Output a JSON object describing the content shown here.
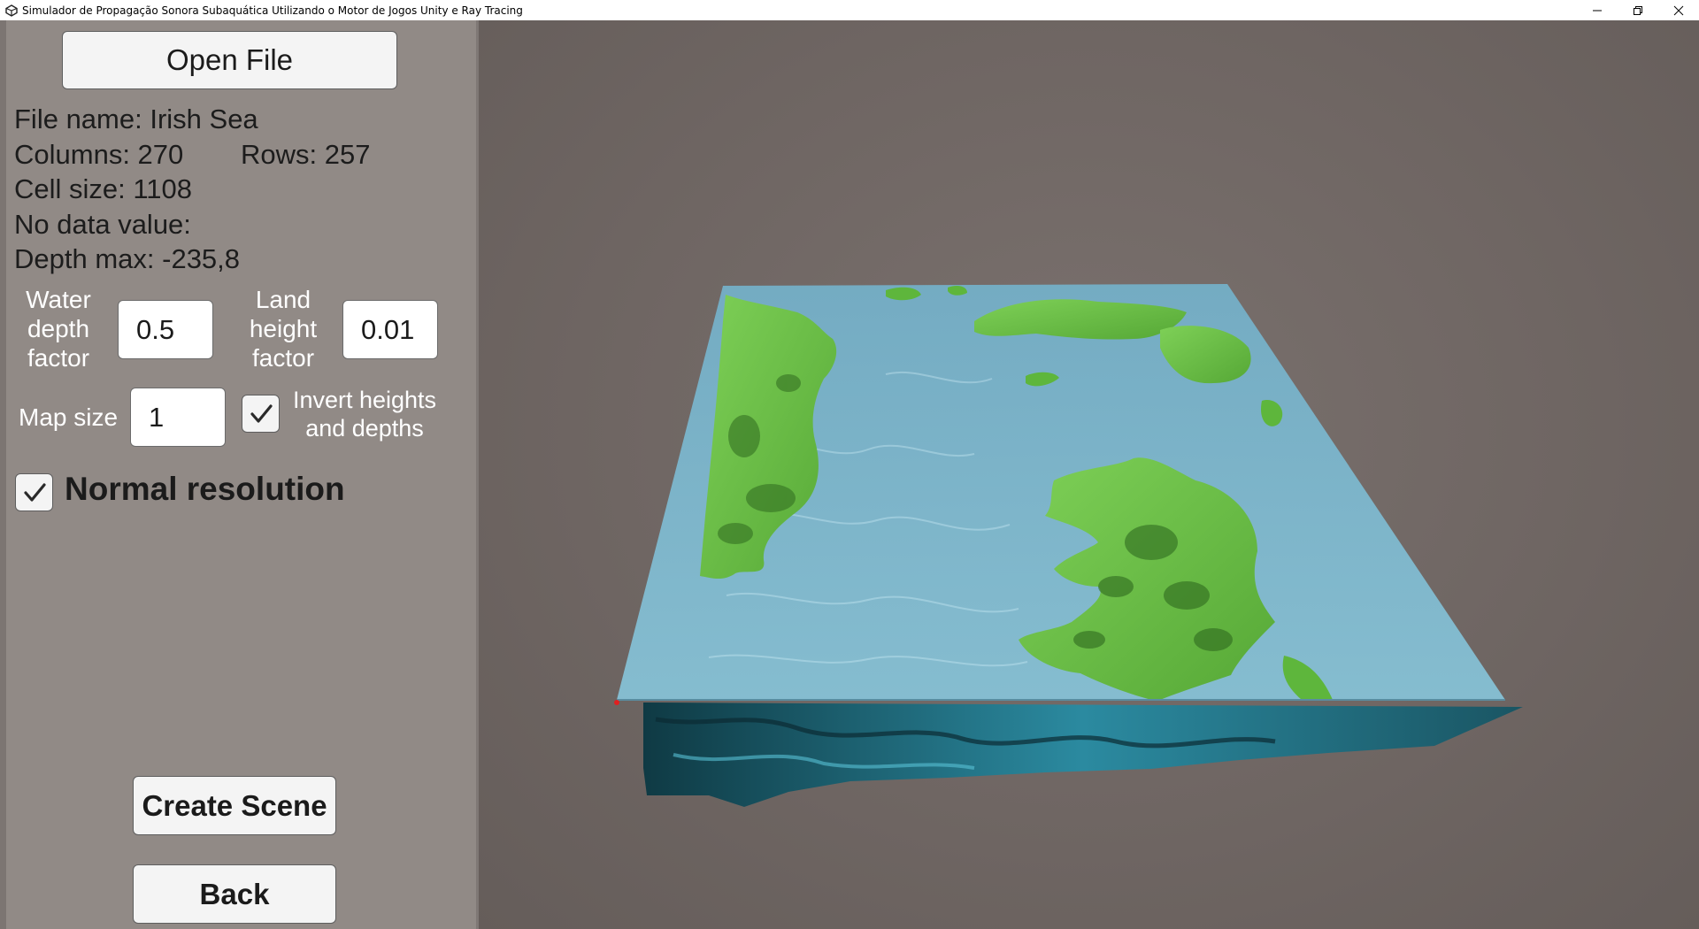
{
  "window": {
    "title": "Simulador de Propagação Sonora Subaquática Utilizando o Motor de Jogos Unity e Ray Tracing",
    "icon": "unity-icon",
    "controls": [
      "minimize-icon",
      "restore-icon",
      "close-icon"
    ]
  },
  "panel": {
    "open_file_label": "Open File",
    "file_name": "File name: Irish Sea",
    "columns": "Columns: 270",
    "rows": "Rows: 257",
    "cell_size": "Cell size: 1108",
    "no_data_value": "No data value:",
    "depth_max": "Depth max: -235,8",
    "water_depth_label": "Water\ndepth\nfactor",
    "water_depth_value": "0.5",
    "land_height_label": "Land\nheight\nfactor",
    "land_height_value": "0.01",
    "map_size_label": "Map size",
    "map_size_value": "1",
    "invert_label": "Invert heights\nand depths",
    "invert_checked": true,
    "normal_resolution_label": "Normal resolution",
    "normal_resolution_checked": true,
    "create_scene_label": "Create Scene",
    "back_label": "Back"
  },
  "viewport": {
    "content": "3D bathymetry terrain map of the Irish Sea",
    "colors": {
      "background": "#6f6663",
      "land": "#6ebf45",
      "land_dark": "#2f6a1f",
      "water": "#7fb6cc",
      "water_deep": "#2d7f93",
      "marker": "#e02020"
    }
  }
}
